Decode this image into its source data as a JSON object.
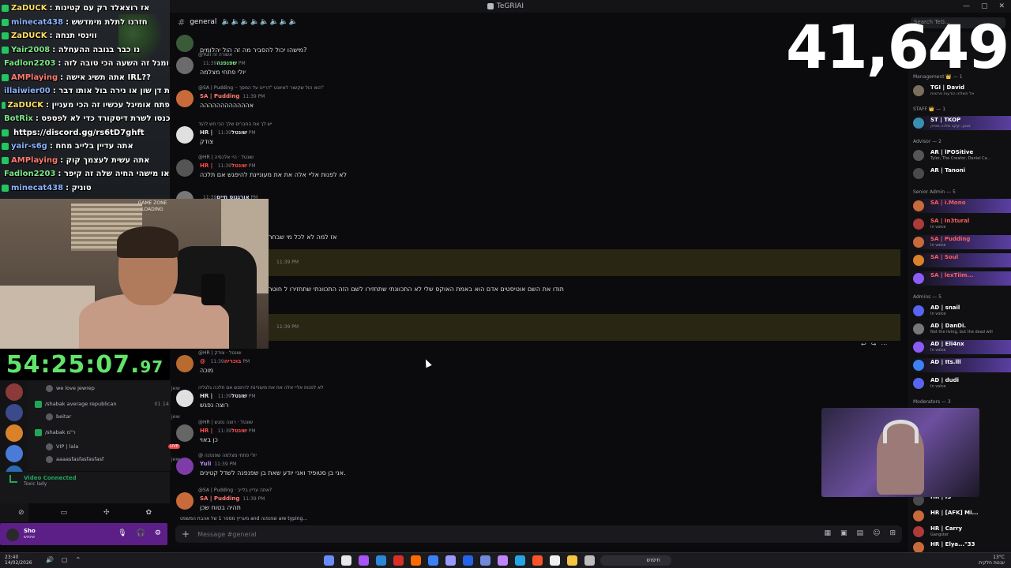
{
  "window": {
    "title": "TeGRIAI",
    "controls": [
      "—",
      "▢",
      "✕"
    ]
  },
  "channel": {
    "name": "general",
    "topic_emojis": "🔈🔈🔈🔈🔈🔈🔈🔈"
  },
  "search": {
    "placeholder": "Search TeG..."
  },
  "sub_count": "41,649",
  "timer": {
    "main": "54:25:07.",
    "fraction": "97"
  },
  "stream_chat": [
    {
      "user": "ZaDUCK",
      "text": ": אז רוצאלד רק עם קטינות",
      "color": "#ffe066"
    },
    {
      "user": "minecat438",
      "text": ": חזרנו לתלת מימדשש",
      "color": "#8ab4ff"
    },
    {
      "user": "ZaDUCK",
      "text": ": ווינסי תנחה",
      "color": "#ffe066"
    },
    {
      "user": "Yair2008",
      "text": ": נו כבר בגובה ההעחלה",
      "color": "#7ee787"
    },
    {
      "user": "Fadlon2203",
      "text": ": עושה כבר אומגל זה השעה הכי טובה לזה",
      "color": "#7ee787"
    },
    {
      "user": "AMPlaying",
      "text": ": אתה תשיג אישה IRL??",
      "color": "#ff7b72"
    },
    {
      "user": "illaiwier00",
      "text": ": כך את דן שון או נירה בול אותו דבר",
      "color": "#8ab4ff"
    },
    {
      "user": "ZaDUCK",
      "text": ": פתח אומיגל עכשיו זה הכי מעניין",
      "color": "#ffe066"
    },
    {
      "user": "BotRix",
      "text": ": את אתה נהגים מהשידורים כנסו לשרת דיסקורד כדי לא לפספס",
      "color": "#7ee787"
    },
    {
      "user": "",
      "text": "https://discord.gg/rs6tD7ghft",
      "color": "#ffffff"
    },
    {
      "user": "yair-s6g",
      "text": ": אתה עדיין בלייב מחח",
      "color": "#8ab4ff"
    },
    {
      "user": "AMPlaying",
      "text": ": אתה עשית לעצמך קוק",
      "color": "#ff7b72"
    },
    {
      "user": "Fadlon2203",
      "text": ": שו מה אתה מעדיף כוסית או מישהי החיה שלה זה קיפר",
      "color": "#7ee787"
    },
    {
      "user": "minecat438",
      "text": ": טוניק",
      "color": "#8ab4ff"
    }
  ],
  "webcam": {
    "sign": "GAME ZONE\nLOADING"
  },
  "messages": [
    {
      "reply": "",
      "author": "",
      "author_color": "#f2b0a0",
      "time": "",
      "body": "מישהו יכול להסביר מה זה הול יהלומים?",
      "highlight": false
    },
    {
      "reply": "@Yuli אשורה זה",
      "author": "שפנפנה",
      "author_color": "#7ee787",
      "time": "11:39 PM",
      "body": "יולי פתחי מצלמה",
      "highlight": false
    },
    {
      "reply": "@SA | Pudding ·· הוא הול שקשור לאיוונט \"דרייט על המסך\"",
      "author": "SA | Pudding",
      "author_color": "#ff7b72",
      "time": "11:39 PM",
      "body": "אהההההההההההה",
      "highlight": false
    },
    {
      "reply": "יש לך את החברים שלך הכי חש להוד",
      "author": "HR | שונטל",
      "author_color": "#dbdee1",
      "time": "11:39 PM",
      "body": "צודק",
      "highlight": false
    },
    {
      "reply": "@HR | שונטל · היי אלכסיה",
      "author": "HR | שונטל",
      "author_color": "#ff4d4d",
      "time": "11:39 PM",
      "body": "לא לפנות אליי אלה את את מעוניינת להיפגש אם תלכה",
      "highlight": false
    },
    {
      "reply": "",
      "author": "אורגנוס חיים",
      "author_color": "#c9cdfb",
      "time": "11:39 PM",
      "body": "",
      "highlight": false
    },
    {
      "reply": "",
      "author": "",
      "author_color": "#dbdee1",
      "time": "",
      "body": "אז למה לא לכל מי שבחר",
      "highlight": false
    },
    {
      "reply": "",
      "author": "",
      "author_color": "#dbdee1",
      "time": "11:39 PM",
      "body": "",
      "highlight": true
    },
    {
      "reply": "",
      "author": "",
      "author_color": "#dbdee1",
      "time": "",
      "body": "תודו את השם אוטיסטים אדם הוא באמת האוקס שלי לא התכוונתי שתחזירו לשם הזה התכוונתי שתחזירו ל חוטר",
      "highlight": false
    },
    {
      "reply": "",
      "author": "",
      "author_color": "#dbdee1",
      "time": "11:39 PM",
      "body": "",
      "highlight": true
    },
    {
      "reply": "@HR | שונטל · צודק",
      "author": "@ בוכריה",
      "author_color": "#ff4d4d",
      "time": "11:39 PM",
      "body": "מוכה",
      "highlight": false
    },
    {
      "reply": "לא לפנות אליי אלה את את מעוניינת להיפגש אם תלכה גלגליה",
      "author": "HR | שונטל",
      "author_color": "#dbdee1",
      "time": "11:39 PM",
      "body": "רוצה נפגש",
      "highlight": false
    },
    {
      "reply": "@HR | שונטל · רוצה נפגש",
      "author": "HR | שונטל",
      "author_color": "#ff4d4d",
      "time": "11:39 PM",
      "body": "כן באוי",
      "highlight": false
    },
    {
      "reply": "@ יולי פתחי מצלמה שפנפנה",
      "author": "Yuli",
      "author_color": "#c084fc",
      "time": "11:39 PM",
      "body": "אני בן סטופיד ואני יודע שאת בן שפנפנה לשדל קטינים.",
      "highlight": false
    },
    {
      "reply": "@SA | Pudding · אתה עדיין בלייב?",
      "author": "SA | Pudding",
      "author_color": "#ff7b72",
      "time": "11:39 PM",
      "body": "תהיה בטוח שכן",
      "highlight": false
    }
  ],
  "typing": "מעריץ מספר 1 של אהבת המשפט and שפנפנה are typing...",
  "composer": {
    "placeholder": "Message #general"
  },
  "voice_list": [
    {
      "name": "we love jewrep",
      "tag": "jew",
      "kind": "user"
    },
    {
      "name": "/shabak average republican",
      "tag": "01  14",
      "kind": "channel"
    },
    {
      "name": "beitar",
      "tag": "jew",
      "kind": "user"
    },
    {
      "name": "/shabak ר\"מ",
      "tag": "",
      "kind": "channel"
    },
    {
      "name": "VIP | lala",
      "tag": "LIVE",
      "kind": "live"
    },
    {
      "name": "aaaasfasfasfasfasf",
      "tag": "jew",
      "kind": "user"
    }
  ],
  "voice_panel": {
    "title": "Video Connected",
    "subtitle": "Toxic lady"
  },
  "user_panel": {
    "name": "Sho",
    "status": "שימוש"
  },
  "members": {
    "groups": [
      {
        "label": "Management 👑 — 1",
        "rows": [
          {
            "name": "TGI | David",
            "sub": "אל תשלחו הודעות פרטיות",
            "color": "#ffffff",
            "banner": false
          }
        ]
      },
      {
        "label": "STAFF 👑 — 1",
        "rows": [
          {
            "name": "ST | TKOP",
            "sub": "מנוע, יעקב מלכה מותק",
            "color": "#ffffff",
            "banner": true
          }
        ]
      },
      {
        "label": "Advisor — 2",
        "rows": [
          {
            "name": "AR | lPOSitive",
            "sub": "Tyler, The Creator, Daniel Ca...",
            "color": "#ffffff",
            "banner": false
          },
          {
            "name": "AR | Tanoni",
            "sub": "",
            "color": "#ffffff",
            "banner": false
          }
        ]
      },
      {
        "label": "Senior Admin — 5",
        "rows": [
          {
            "name": "SA | i.Mono",
            "sub": "",
            "color": "#ff5f5f",
            "banner": true
          },
          {
            "name": "SA | In3tural",
            "sub": "In voice",
            "color": "#ff5f5f",
            "banner": false
          },
          {
            "name": "SA | Pudding",
            "sub": "In voice",
            "color": "#ff5f5f",
            "banner": true
          },
          {
            "name": "SA | Soul",
            "sub": "",
            "color": "#ff5f5f",
            "banner": true
          },
          {
            "name": "SA | lexTiim...",
            "sub": "",
            "color": "#ff5f5f",
            "banner": true
          }
        ]
      },
      {
        "label": "Admins — 5",
        "rows": [
          {
            "name": "AD | snail",
            "sub": "In voice",
            "color": "#ffffff",
            "banner": false
          },
          {
            "name": "AD | DanDi.",
            "sub": "Not the living, but the dead will",
            "color": "#ffffff",
            "banner": false
          },
          {
            "name": "AD | Eli4nx",
            "sub": "In voice",
            "color": "#ffffff",
            "banner": true
          },
          {
            "name": "AD | Its.lll",
            "sub": "",
            "color": "#ffffff",
            "banner": true
          },
          {
            "name": "AD | dudi",
            "sub": "In voice",
            "color": "#ffffff",
            "banner": false
          }
        ]
      },
      {
        "label": "Moderators — 3",
        "rows": []
      }
    ],
    "bottom_rows": [
      {
        "name": "HR | IS",
        "sub": "",
        "color": "#ffffff"
      },
      {
        "name": "HR | [AFK] Mi...",
        "sub": "",
        "color": "#ffffff"
      },
      {
        "name": "HR | Carry",
        "sub": "Gangster",
        "color": "#ffffff"
      },
      {
        "name": "HR | Elya...\"33",
        "sub": "",
        "color": "#ffffff"
      }
    ]
  },
  "taskbar": {
    "left_temp": "23:40",
    "left_date": "14/02/2026",
    "search_label": "חיפוש",
    "right_line1": "13°C",
    "right_line2": "עננות חלקית",
    "app_colors": [
      "#6b8cff",
      "#e7e7e7",
      "#a855f7",
      "#2b88d8",
      "#d93025",
      "#ff6a00",
      "#3b82f6",
      "#9999ff",
      "#2563eb",
      "#7289da",
      "#c084fc",
      "#26a5e4",
      "#fb542b",
      "#f0f0f0",
      "#f4c542",
      "#bdbdbd"
    ]
  }
}
